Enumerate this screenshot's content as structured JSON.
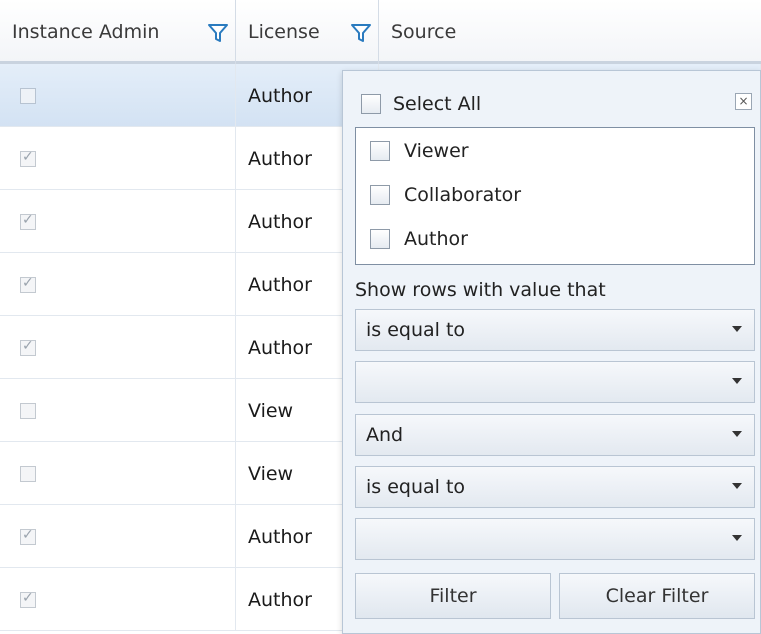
{
  "grid": {
    "columns": [
      {
        "label": "Instance Admin",
        "has_filter": true
      },
      {
        "label": "License",
        "has_filter": true
      },
      {
        "label": "Source",
        "has_filter": false
      }
    ],
    "rows": [
      {
        "admin_checked": false,
        "license": "Author",
        "selected": true
      },
      {
        "admin_checked": true,
        "license": "Author",
        "selected": false
      },
      {
        "admin_checked": true,
        "license": "Author",
        "selected": false
      },
      {
        "admin_checked": true,
        "license": "Author",
        "selected": false
      },
      {
        "admin_checked": true,
        "license": "Author",
        "selected": false
      },
      {
        "admin_checked": false,
        "license": "View",
        "selected": false
      },
      {
        "admin_checked": false,
        "license": "View",
        "selected": false
      },
      {
        "admin_checked": true,
        "license": "Author",
        "selected": false
      },
      {
        "admin_checked": true,
        "license": "Author",
        "selected": false
      }
    ]
  },
  "filter_popup": {
    "select_all_label": "Select All",
    "close_label": "×",
    "options": [
      {
        "label": "Viewer",
        "checked": false
      },
      {
        "label": "Collaborator",
        "checked": false
      },
      {
        "label": "Author",
        "checked": false
      }
    ],
    "show_rows_label": "Show rows with value that",
    "operator1": "is equal to",
    "value1": "",
    "logic": "And",
    "operator2": "is equal to",
    "value2": "",
    "filter_button": "Filter",
    "clear_button": "Clear Filter"
  },
  "colors": {
    "filter_icon_fill": "#ffffff",
    "filter_icon_stroke": "#2a7bbf",
    "selected_row": "#dbe7f5",
    "popup_bg": "#eef3f9"
  }
}
